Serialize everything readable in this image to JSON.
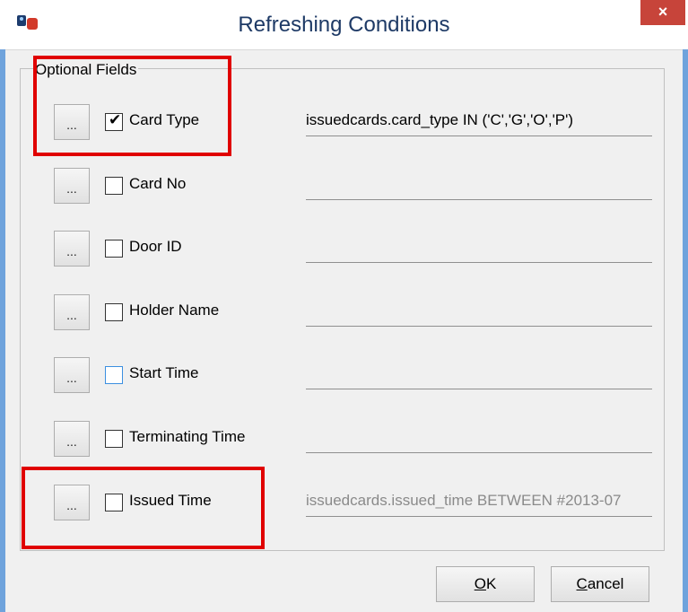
{
  "window": {
    "title": "Refreshing Conditions",
    "close_glyph": "×"
  },
  "group": {
    "label": "Optional Fields"
  },
  "fields": [
    {
      "label": "Card Type",
      "checked": true,
      "condition": "issuedcards.card_type IN ('C','G','O','P')",
      "ellipsis": "..."
    },
    {
      "label": "Card No",
      "checked": false,
      "condition": "",
      "ellipsis": "..."
    },
    {
      "label": "Door ID",
      "checked": false,
      "condition": "",
      "ellipsis": "..."
    },
    {
      "label": "Holder Name",
      "checked": false,
      "condition": "",
      "ellipsis": "..."
    },
    {
      "label": "Start Time",
      "checked": false,
      "condition": "",
      "ellipsis": "..."
    },
    {
      "label": "Terminating Time",
      "checked": false,
      "condition": "",
      "ellipsis": "..."
    },
    {
      "label": "Issued Time",
      "checked": false,
      "condition": "issuedcards.issued_time BETWEEN #2013-07",
      "ellipsis": "..."
    }
  ],
  "buttons": {
    "ok_mnemonic": "O",
    "ok_rest": "K",
    "cancel_mnemonic": "C",
    "cancel_rest": "ancel"
  },
  "colors": {
    "highlight": "#e00000",
    "title_text": "#1e3a66",
    "close_button": "#c7443a",
    "window_border": "#6fa3dc"
  }
}
